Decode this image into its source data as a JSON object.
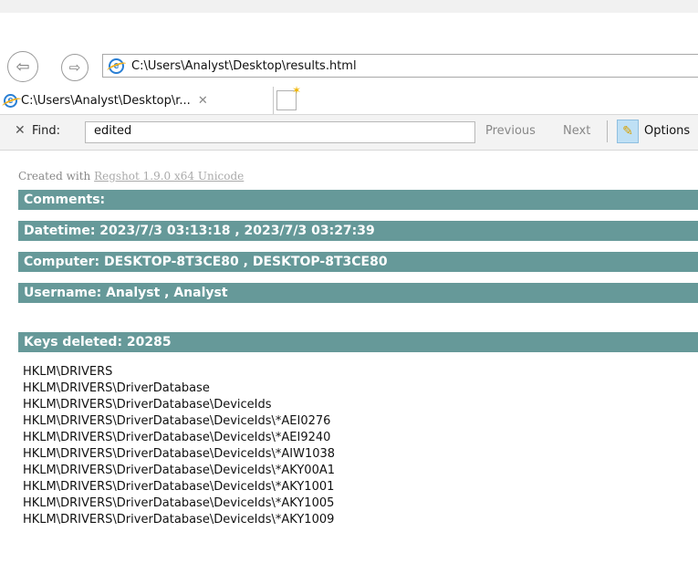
{
  "browser": {
    "address": "C:\\Users\\Analyst\\Desktop\\results.html",
    "tab_label": "C:\\Users\\Analyst\\Desktop\\r...",
    "icons": [
      "back-icon",
      "forward-icon",
      "ie-icon",
      "close-icon",
      "new-tab-icon",
      "pencil-icon"
    ]
  },
  "find_bar": {
    "close_label": "✕",
    "label": "Find:",
    "value": "edited",
    "previous": "Previous",
    "next": "Next",
    "options": "Options"
  },
  "report": {
    "created_prefix": "Created with",
    "created_link": "Regshot 1.9.0 x64 Unicode",
    "comments": "Comments:",
    "datetime": "Datetime: 2023/7/3 03:13:18 , 2023/7/3 03:27:39",
    "computer": "Computer: DESKTOP-8T3CE80 , DESKTOP-8T3CE80",
    "username": "Username: Analyst , Analyst",
    "keys_deleted": "Keys deleted: 20285",
    "keys": [
      "HKLM\\DRIVERS",
      "HKLM\\DRIVERS\\DriverDatabase",
      "HKLM\\DRIVERS\\DriverDatabase\\DeviceIds",
      "HKLM\\DRIVERS\\DriverDatabase\\DeviceIds\\*AEI0276",
      "HKLM\\DRIVERS\\DriverDatabase\\DeviceIds\\*AEI9240",
      "HKLM\\DRIVERS\\DriverDatabase\\DeviceIds\\*AIW1038",
      "HKLM\\DRIVERS\\DriverDatabase\\DeviceIds\\*AKY00A1",
      "HKLM\\DRIVERS\\DriverDatabase\\DeviceIds\\*AKY1001",
      "HKLM\\DRIVERS\\DriverDatabase\\DeviceIds\\*AKY1005",
      "HKLM\\DRIVERS\\DriverDatabase\\DeviceIds\\*AKY1009"
    ],
    "bar_color": "#669999"
  }
}
